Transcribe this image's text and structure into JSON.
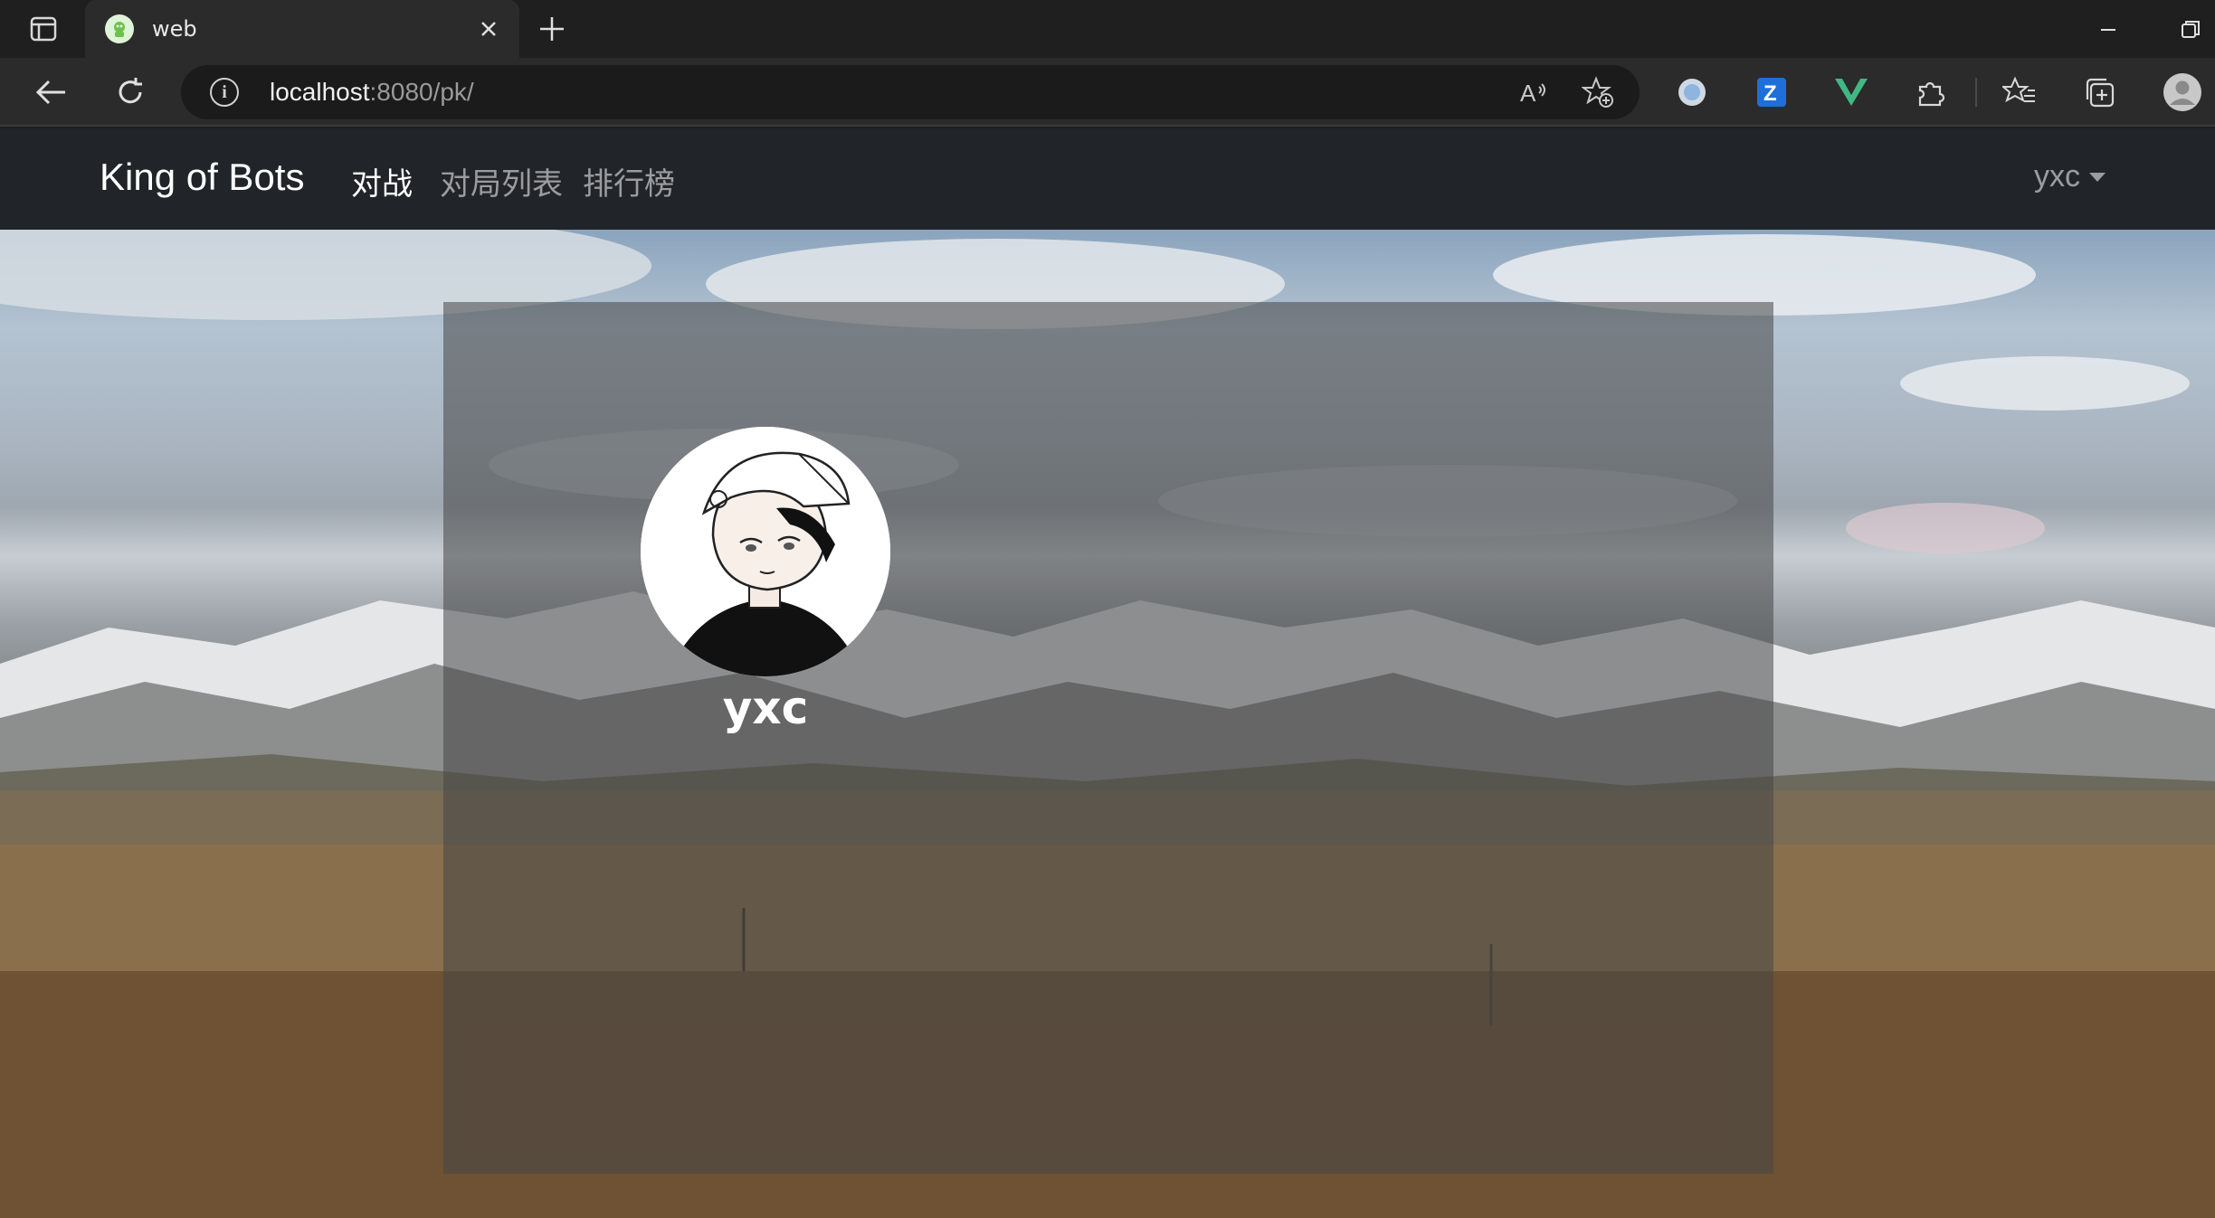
{
  "browser": {
    "tab_title": "web",
    "url_host": "localhost",
    "url_rest": ":8080/pk/"
  },
  "navbar": {
    "brand": "King of Bots",
    "links": [
      {
        "label": "对战",
        "active": true
      },
      {
        "label": "对局列表",
        "active": false
      },
      {
        "label": "排行榜",
        "active": false
      }
    ],
    "user": "yxc"
  },
  "profile": {
    "username": "yxc"
  },
  "icons": {
    "tab": [
      "sidebar-toggle-icon",
      "favicon-icon",
      "close-icon",
      "plus-icon"
    ],
    "toolbar": [
      "back-arrow-icon",
      "refresh-icon",
      "info-icon",
      "read-aloud-icon",
      "favorite-add-icon",
      "extension-circle-icon",
      "extension-z-icon",
      "vue-icon",
      "puzzle-icon",
      "favorites-icon",
      "collections-icon",
      "profile-icon"
    ]
  },
  "colors": {
    "navbar_bg": "#212529",
    "card_overlay": "rgba(70,70,70,0.55)",
    "vue_green": "#41b883",
    "ext_blue": "#1e6fd9"
  }
}
